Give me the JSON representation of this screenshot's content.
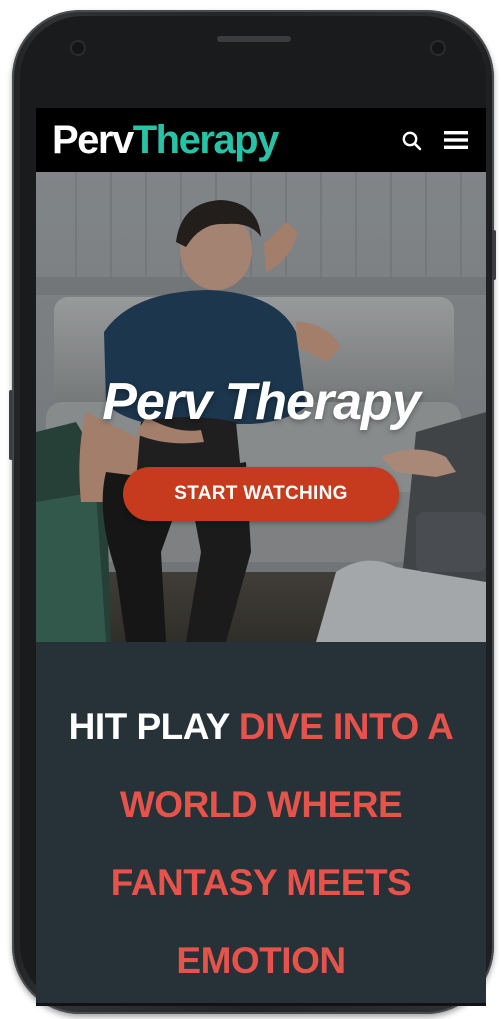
{
  "brand": {
    "part1": "Perv",
    "part2": "Therapy"
  },
  "nav": {
    "search_icon": "search-icon",
    "menu_icon": "hamburger-menu-icon"
  },
  "hero": {
    "title": "Perv Therapy",
    "cta_label": "START WATCHING"
  },
  "tagline": {
    "lead": "HIT PLAY",
    "accent": "DIVE INTO A WORLD WHERE FANTASY MEETS EMOTION"
  },
  "colors": {
    "brand_accent": "#27c3a6",
    "cta_background": "#c63a1d",
    "tagline_accent": "#e5534b",
    "section_background": "#263238",
    "navbar_background": "#000000"
  }
}
